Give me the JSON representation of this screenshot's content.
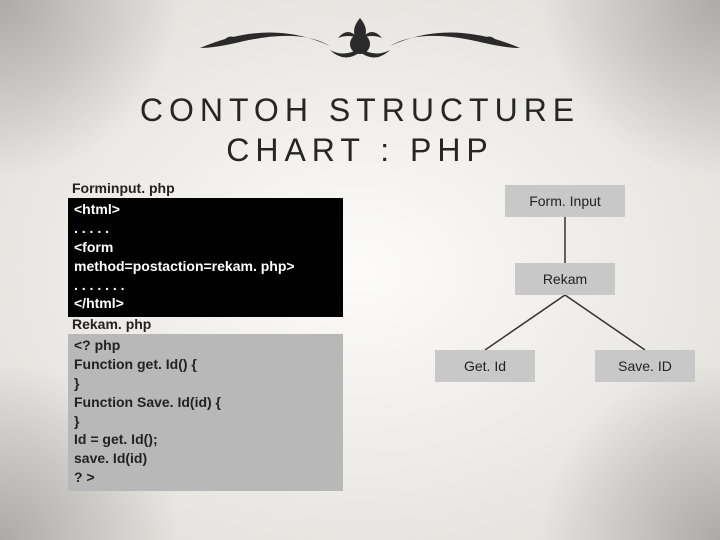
{
  "title_line1": "CONTOH STRUCTURE",
  "title_line2": "CHART : PHP",
  "code": {
    "file1_label": "Forminput. php",
    "block1": "<html>\n. . . . .\n<form\nmethod=postaction=rekam. php>\n. . . . . . .\n</html>",
    "file2_label": "Rekam. php",
    "block2": "<? php\nFunction get. Id() {\n}\nFunction Save. Id(id) {\n}\nId = get. Id();\nsave. Id(id)\n? >"
  },
  "chart": {
    "nodes": {
      "root": "Form. Input",
      "mid": "Rekam",
      "leaf_left": "Get. Id",
      "leaf_right": "Save. ID"
    }
  }
}
